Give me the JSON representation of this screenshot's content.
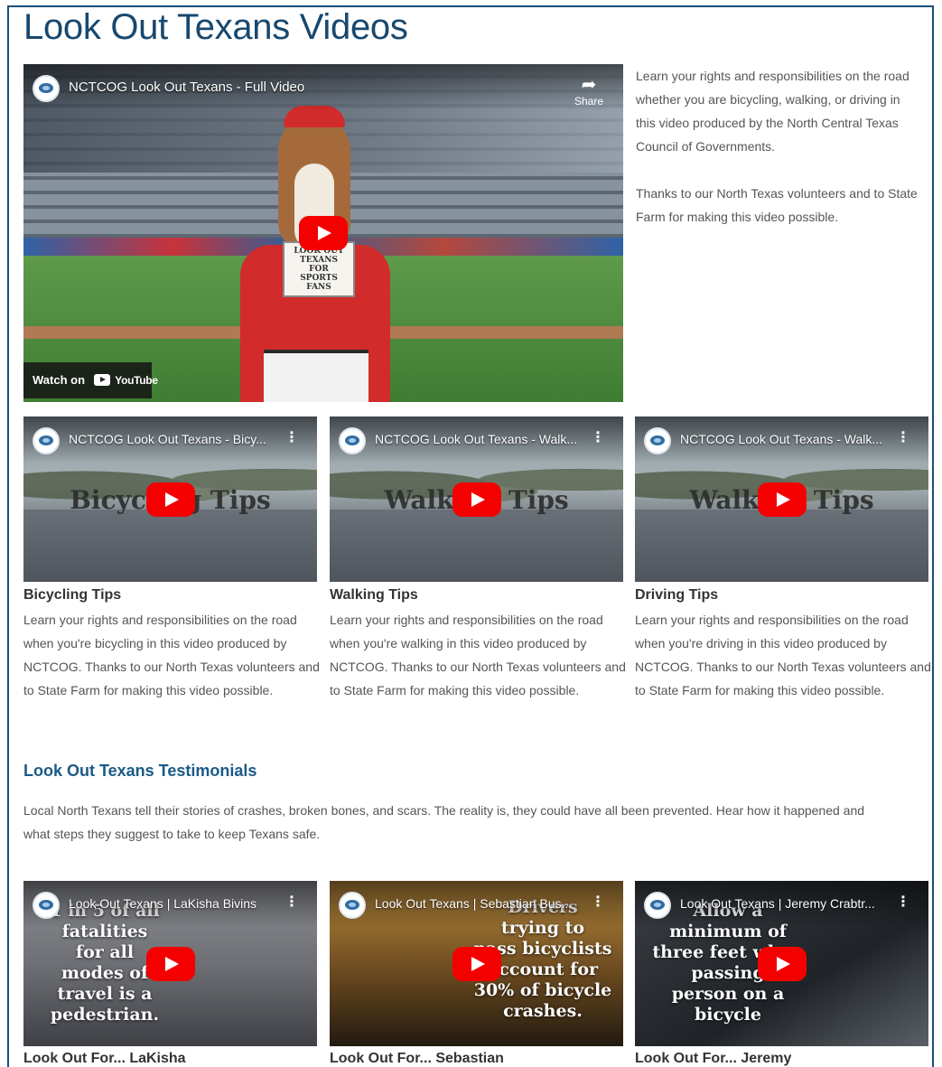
{
  "page": {
    "title": "Look Out Texans Videos"
  },
  "main_video": {
    "title": "NCTCOG Look Out Texans - Full Video",
    "share_label": "Share",
    "watch_label": "Watch on",
    "youtube_label": "YouTube",
    "sign_text": "LOOK OUT\nTEXANS\nFOR\nSPORTS\nFANS",
    "description_1": "Learn your rights and responsibilities on the road whether you are bicycling, walking, or driving in this video produced by the North Central Texas Council of Governments.",
    "description_2": "Thanks to our North Texas volunteers and to State Farm for making this video possible."
  },
  "tips_videos": [
    {
      "video_title": "NCTCOG Look Out Texans - Bicy...",
      "thumb_text": "Bicycling Tips",
      "caption": "Bicycling Tips",
      "description": "Learn your rights and responsibilities on the road when you're bicycling in this video produced by NCTCOG. Thanks to our North Texas volunteers and to State Farm for making this video possible."
    },
    {
      "video_title": "NCTCOG Look Out Texans - Walk...",
      "thumb_text": "Walking Tips",
      "caption": "Walking Tips",
      "description": "Learn your rights and responsibilities on the road when you're walking in this video produced by NCTCOG. Thanks to our North Texas volunteers and to State Farm for making this video possible."
    },
    {
      "video_title": "NCTCOG Look Out Texans - Walk...",
      "thumb_text": "Walking Tips",
      "caption": "Driving Tips",
      "description": "Learn your rights and responsibilities on the road when you're driving in this video produced by NCTCOG. Thanks to our North Texas volunteers and to State Farm for making this video possible."
    }
  ],
  "testimonials": {
    "heading": "Look Out Texans Testimonials",
    "description": "Local North Texans tell their stories of crashes, broken bones, and scars. The reality is, they could have all been prevented. Hear how it happened and what steps they suggest to take to keep Texans safe.",
    "videos": [
      {
        "video_title": "Look Out Texans | LaKisha Bivins",
        "thumb_text": "1 in 5 of all\nfatalities\nfor all\nmodes of\ntravel is a\npedestrian.",
        "caption": "Look Out For... LaKisha"
      },
      {
        "video_title": "Look Out Texans | Sebastian Bus...",
        "thumb_text": "Drivers\ntrying to\npass bicyclists\naccount for\n30% of bicycle\ncrashes.",
        "caption": "Look Out For... Sebastian"
      },
      {
        "video_title": "Look Out Texans | Jeremy Crabtr...",
        "thumb_text": "Allow a\nminimum of\nthree feet when\npassing\nperson on a\nbicycle",
        "caption": "Look Out For... Jeremy"
      }
    ]
  },
  "icons": {
    "more": "more-vertical-icon",
    "play": "play-icon",
    "share": "share-icon",
    "channel": "nctcog-channel-logo"
  },
  "colors": {
    "title": "#18486e",
    "heading": "#1a5a86",
    "play": "#f40000",
    "frame": "#1a4f78"
  }
}
